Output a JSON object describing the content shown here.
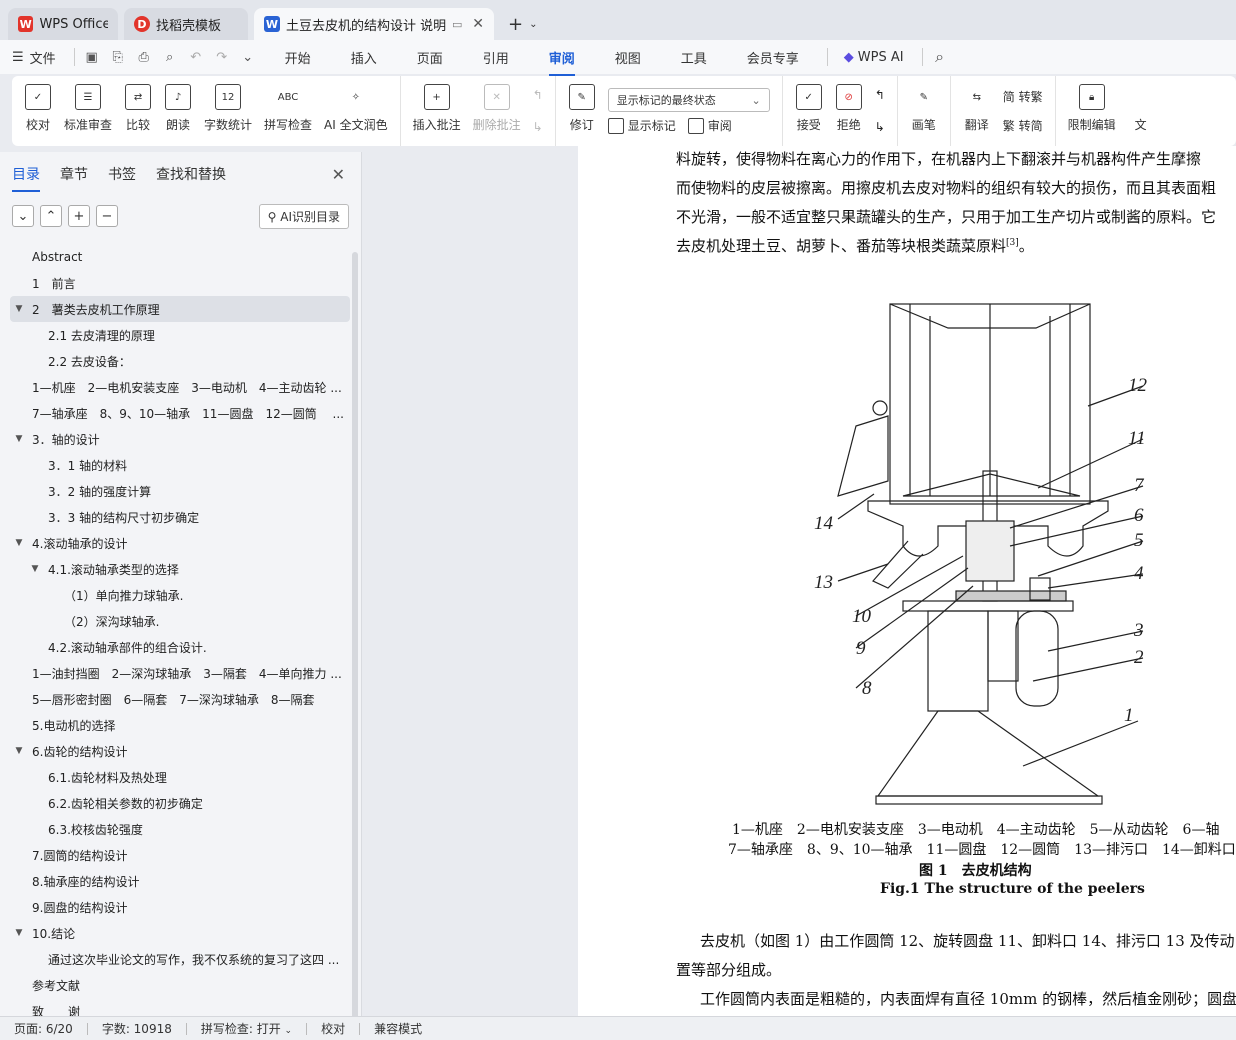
{
  "tabs": [
    {
      "label": "WPS Office",
      "icon": "wps-logo-icon"
    },
    {
      "label": "找稻壳模板",
      "icon": "docer-icon"
    },
    {
      "label": "土豆去皮机的结构设计 说明书",
      "icon": "word-doc-icon"
    }
  ],
  "menu": {
    "file": "文件",
    "tabs": [
      "开始",
      "插入",
      "页面",
      "引用",
      "审阅",
      "视图",
      "工具",
      "会员专享"
    ],
    "active_tab": "审阅",
    "wps_ai": "WPS AI"
  },
  "ribbon": {
    "proofread": "校对",
    "standard_review": "标准审查",
    "compare": "比较",
    "read_aloud": "朗读",
    "word_count": "字数统计",
    "spell_check": "拼写检查",
    "ai_polish": "AI 全文润色",
    "insert_comment": "插入批注",
    "delete_comment": "删除批注",
    "track_changes": "修订",
    "markup_dropdown": "显示标记的最终状态",
    "show_markup": "显示标记",
    "review": "审阅",
    "accept": "接受",
    "reject": "拒绝",
    "ink": "画笔",
    "translate": "翻译",
    "to_traditional": "简 转繁",
    "to_simplified": "繁 转简",
    "restrict_editing": "限制编辑",
    "document_rights": "文"
  },
  "panel": {
    "tabs": [
      "目录",
      "章节",
      "书签",
      "查找和替换"
    ],
    "ai_toc": "AI识别目录",
    "toc": [
      {
        "text": "Abstract",
        "indent": 0,
        "caret": ""
      },
      {
        "text": "1　前言",
        "indent": 0,
        "caret": ""
      },
      {
        "text": "2　薯类去皮机工作原理",
        "indent": 0,
        "caret": "▼",
        "selected": true
      },
      {
        "text": "2.1 去皮清理的原理",
        "indent": 1,
        "caret": ""
      },
      {
        "text": "2.2 去皮设备：",
        "indent": 1,
        "caret": ""
      },
      {
        "text": "1—机座　2—电机安装支座　3—电动机　4—主动齿轮 ...",
        "indent": 0,
        "caret": ""
      },
      {
        "text": "7—轴承座　8、9、10—轴承　11—圆盘　12—圆筒　 ...",
        "indent": 0,
        "caret": ""
      },
      {
        "text": "3．轴的设计",
        "indent": 0,
        "caret": "▼"
      },
      {
        "text": "3．1 轴的材料",
        "indent": 1,
        "caret": ""
      },
      {
        "text": "3．2 轴的强度计算",
        "indent": 1,
        "caret": ""
      },
      {
        "text": "3．3 轴的结构尺寸初步确定",
        "indent": 1,
        "caret": ""
      },
      {
        "text": "4.滚动轴承的设计",
        "indent": 0,
        "caret": "▼"
      },
      {
        "text": "4.1.滚动轴承类型的选择",
        "indent": 1,
        "caret": "▼"
      },
      {
        "text": "（1）单向推力球轴承.",
        "indent": 2,
        "caret": ""
      },
      {
        "text": "（2）深沟球轴承.",
        "indent": 2,
        "caret": ""
      },
      {
        "text": "4.2.滚动轴承部件的组合设计.",
        "indent": 1,
        "caret": ""
      },
      {
        "text": "1—油封挡圈　2—深沟球轴承　3—隔套　4—单向推力 ...",
        "indent": 0,
        "caret": ""
      },
      {
        "text": "5—唇形密封圈　6—隔套　7—深沟球轴承　8—隔套",
        "indent": 0,
        "caret": ""
      },
      {
        "text": "5.电动机的选择",
        "indent": 0,
        "caret": ""
      },
      {
        "text": "6.齿轮的结构设计",
        "indent": 0,
        "caret": "▼"
      },
      {
        "text": "6.1.齿轮材料及热处理",
        "indent": 1,
        "caret": ""
      },
      {
        "text": "6.2.齿轮相关参数的初步确定",
        "indent": 1,
        "caret": ""
      },
      {
        "text": "6.3.校核齿轮强度",
        "indent": 1,
        "caret": ""
      },
      {
        "text": "7.圆筒的结构设计",
        "indent": 0,
        "caret": ""
      },
      {
        "text": "8.轴承座的结构设计",
        "indent": 0,
        "caret": ""
      },
      {
        "text": "9.圆盘的结构设计",
        "indent": 0,
        "caret": ""
      },
      {
        "text": "10.结论",
        "indent": 0,
        "caret": "▼"
      },
      {
        "text": "通过这次毕业论文的写作，我不仅系统的复习了这四 ...",
        "indent": 1,
        "caret": ""
      },
      {
        "text": "参考文献",
        "indent": 0,
        "caret": ""
      },
      {
        "text": "致　　谢",
        "indent": 0,
        "caret": ""
      }
    ]
  },
  "document": {
    "lines_top": [
      "料旋转，使得物料在离心力的作用下，在机器内上下翻滚并与机器构件产生摩擦",
      "而使物料的皮层被擦离。用擦皮机去皮对物料的组织有较大的损伤，而且其表面粗",
      "不光滑，一般不适宜整只果蔬罐头的生产，只用于加工生产切片或制酱的原料。它",
      "去皮机处理土豆、胡萝卜、番茄等块根类蔬菜原料"
    ],
    "citation": "[3]",
    "period": "。",
    "figure_labels": [
      "12",
      "11",
      "7",
      "6",
      "5",
      "4",
      "3",
      "2",
      "1",
      "14",
      "13",
      "10",
      "9",
      "8"
    ],
    "caption_line1": "1—机座　2—电机安装支座　3—电动机　4—主动齿轮　5—从动齿轮　6—轴",
    "caption_line2": "7—轴承座　8、9、10—轴承　11—圆盘　12—圆筒　13—排污口　14—卸料口",
    "fig_title_cn": "图 1　去皮机结构",
    "fig_title_en": "Fig.1 The structure of the peelers",
    "lines_bottom": [
      "去皮机（如图 1）由工作圆筒 12、旋转圆盘 11、卸料口 14、排污口 13 及传动",
      "置等部分组成。",
      "工作圆筒内表面是粗糙的，内表面焊有直径 10mm 的钢棒，然后植金刚砂；圆盘"
    ]
  },
  "status": {
    "page": "页面: 6/20",
    "words": "字数: 10918",
    "spell": "拼写检查: 打开",
    "proof": "校对",
    "compat": "兼容模式"
  },
  "colors": {
    "accent": "#1f5fd6",
    "wps_red": "#e2342b",
    "doc_blue": "#2a63d4"
  }
}
